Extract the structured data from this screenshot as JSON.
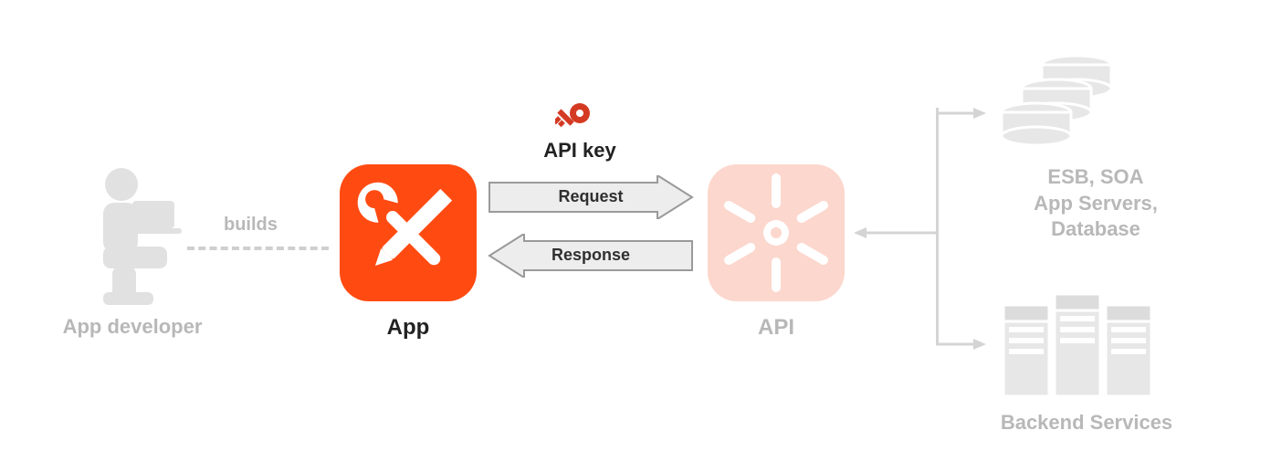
{
  "colors": {
    "accent": "#ff4b12",
    "accent_light": "#fcd7cd",
    "key": "#d43a22",
    "faded": "#b8b8b8",
    "stroke_light": "#d4d4d4",
    "arrow_fill": "#ededed",
    "arrow_stroke": "#9a9a9a"
  },
  "nodes": {
    "developer": {
      "label": "App developer",
      "icon": "person-laptop-icon"
    },
    "app": {
      "label": "App",
      "icon": "tools-icon"
    },
    "apikey": {
      "label": "API key",
      "icon": "key-icon"
    },
    "api": {
      "label": "API",
      "icon": "hub-icon"
    },
    "db": {
      "label": "ESB, SOA\nApp Servers,\nDatabase",
      "icon": "database-stack-icon"
    },
    "servers": {
      "label": "Backend Services",
      "icon": "server-rack-icon"
    }
  },
  "edges": {
    "builds": {
      "from": "developer",
      "to": "app",
      "label": "builds",
      "style": "dashed"
    },
    "request": {
      "from": "app",
      "to": "api",
      "label": "Request",
      "style": "block-arrow-right"
    },
    "response": {
      "from": "api",
      "to": "app",
      "label": "Response",
      "style": "block-arrow-left"
    },
    "api_to_backend": {
      "from": "api",
      "to": [
        "db",
        "servers"
      ],
      "style": "branching-arrows"
    }
  }
}
